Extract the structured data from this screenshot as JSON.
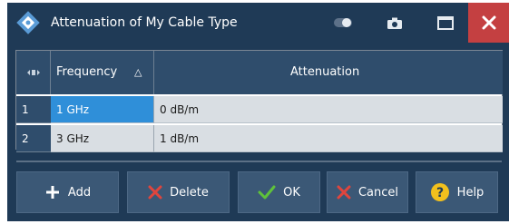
{
  "window": {
    "title": "Attenuation of  My Cable Type",
    "colors": {
      "titlebar": "#1f3a56",
      "close": "#c44041",
      "selection": "#2f8fd9"
    }
  },
  "titlebar_controls": [
    {
      "icon": "toggle-icon"
    },
    {
      "icon": "camera-icon"
    },
    {
      "icon": "maximize-icon"
    },
    {
      "icon": "close-icon"
    }
  ],
  "table": {
    "row_header_icon": "column-resize-icon",
    "columns": [
      "Frequency",
      "Attenuation"
    ],
    "sort_indicator": "△",
    "rows": [
      {
        "index": "1",
        "frequency": "1 GHz",
        "attenuation": "0 dB/m",
        "selected": true
      },
      {
        "index": "2",
        "frequency": "3 GHz",
        "attenuation": "1 dB/m",
        "selected": false
      }
    ]
  },
  "buttons": {
    "add": "Add",
    "delete": "Delete",
    "ok": "OK",
    "cancel": "Cancel",
    "help": "Help"
  }
}
